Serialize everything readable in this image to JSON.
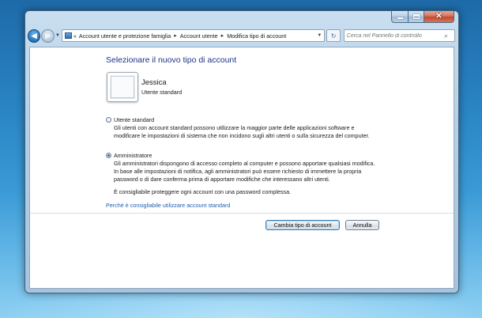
{
  "window": {
    "controls": {
      "minimize": "—",
      "maximize": "▢",
      "close": "✕"
    }
  },
  "nav": {
    "back_glyph": "◀",
    "forward_glyph": "▶",
    "dropdown_glyph": "▼",
    "refresh_glyph": "↻"
  },
  "breadcrumb": {
    "prefix": "«",
    "items": [
      "Account utente e protezione famiglia",
      "Account utente",
      "Modifica tipo di account"
    ],
    "separator": "▸"
  },
  "search": {
    "placeholder": "Cerca nel Pannello di controllo"
  },
  "page": {
    "title": "Selezionare il nuovo tipo di account",
    "user": {
      "name": "Jessica",
      "type": "Utente standard"
    }
  },
  "options": {
    "standard": {
      "label": "Utente standard",
      "line1": "Gli utenti con account standard possono utilizzare la maggior parte delle applicazioni software e",
      "line2": "modificare le impostazioni di sistema che non incidono sugli altri utenti o sulla sicurezza del computer.",
      "selected": false
    },
    "admin": {
      "label": "Amministratore",
      "line1": "Gli amministratori dispongono di accesso completo al computer e possono apportare qualsiasi modifica.",
      "line2": "In base alle impostazioni di notifica, agli amministratori può essere richiesto di immettere la propria",
      "line3": "password o di dare conferma prima di apportare modifiche che interessano altri utenti.",
      "selected": true
    }
  },
  "note": "È consigliabile proteggere ogni account con una password complessa.",
  "link": "Perché è consigliabile utilizzare account standard",
  "buttons": {
    "change": "Cambia tipo di account",
    "cancel": "Annulla"
  }
}
